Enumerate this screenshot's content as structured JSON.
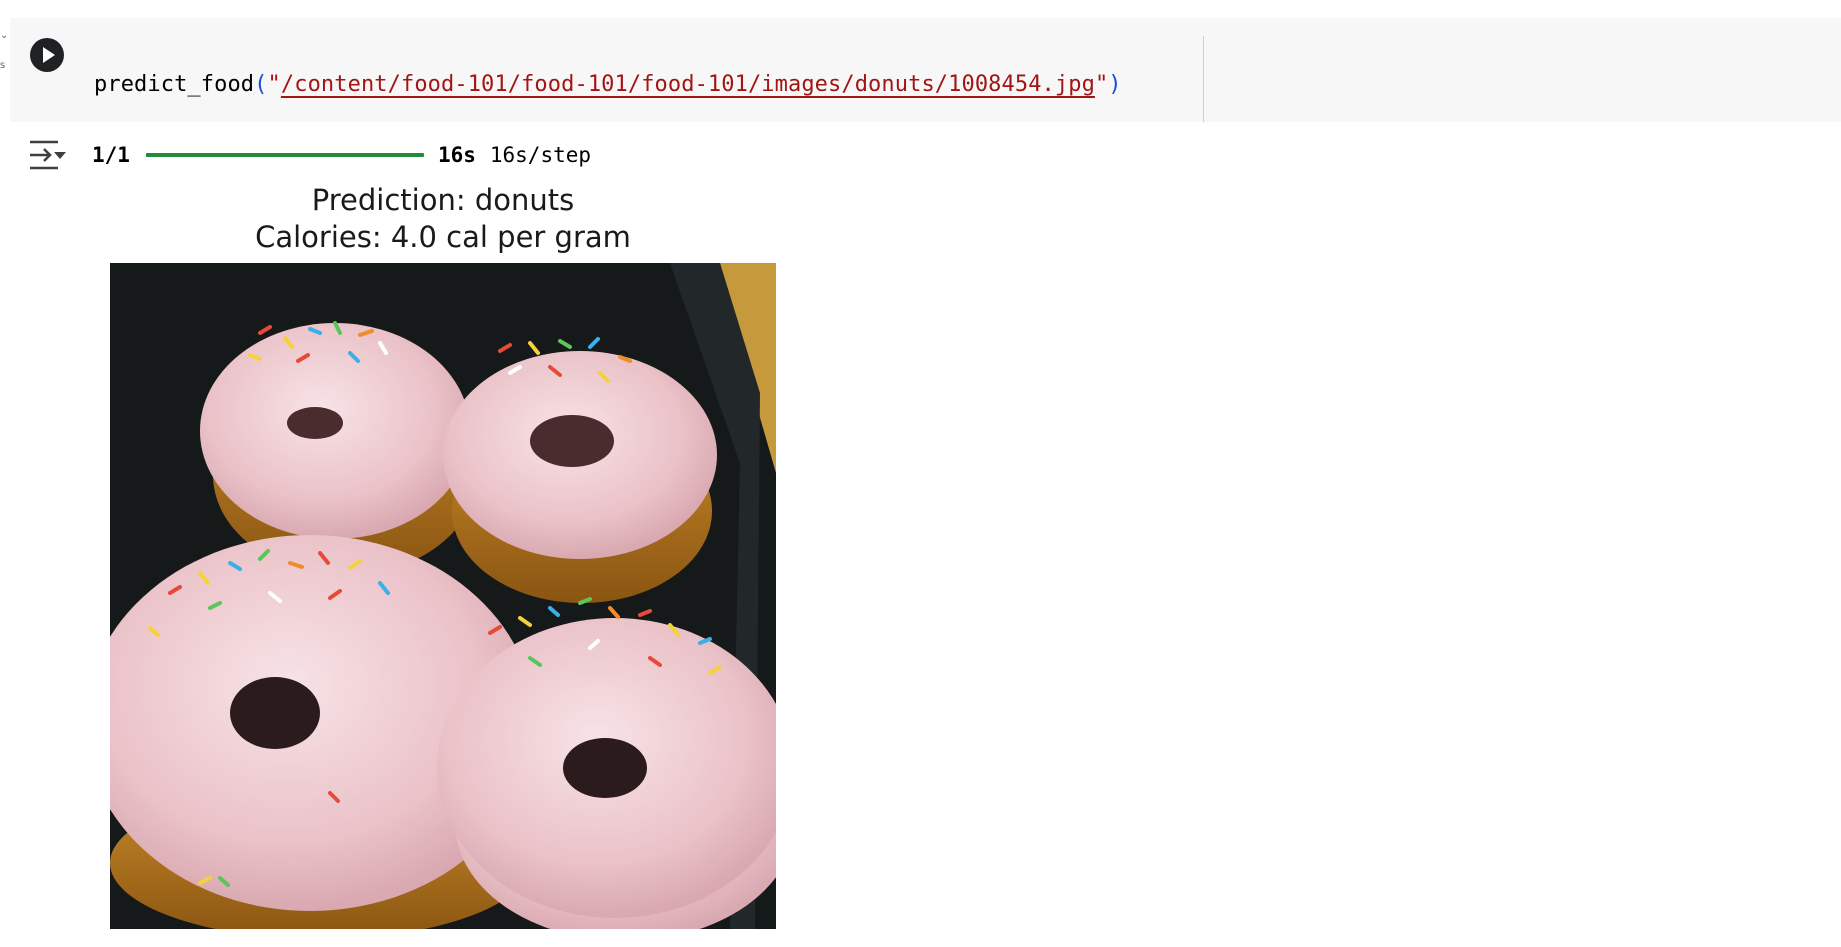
{
  "code_cell": {
    "function_name": "predict_food",
    "open_paren": "(",
    "quote": "\"",
    "path_arg": "/content/food-101/food-101/food-101/images/donuts/1008454.jpg",
    "close_paren": ")"
  },
  "output": {
    "progress": {
      "step": "1/1",
      "fraction_complete": 1.0,
      "elapsed": "16s",
      "rate": "16s/step"
    },
    "plot": {
      "title_line1": "Prediction: donuts",
      "title_line2": "Calories: 4.0 cal per gram",
      "image_subject": "four pink-frosted donuts with rainbow sprinkles on a dark tray"
    }
  },
  "colors": {
    "cell_background": "#f7f7f7",
    "string_literal": "#a31515",
    "parenthesis": "#1a4dd8",
    "progress_bar": "#1e8e3e"
  },
  "icons": {
    "run": "play-circle-icon",
    "output_toggle": "collapse-output-icon"
  }
}
